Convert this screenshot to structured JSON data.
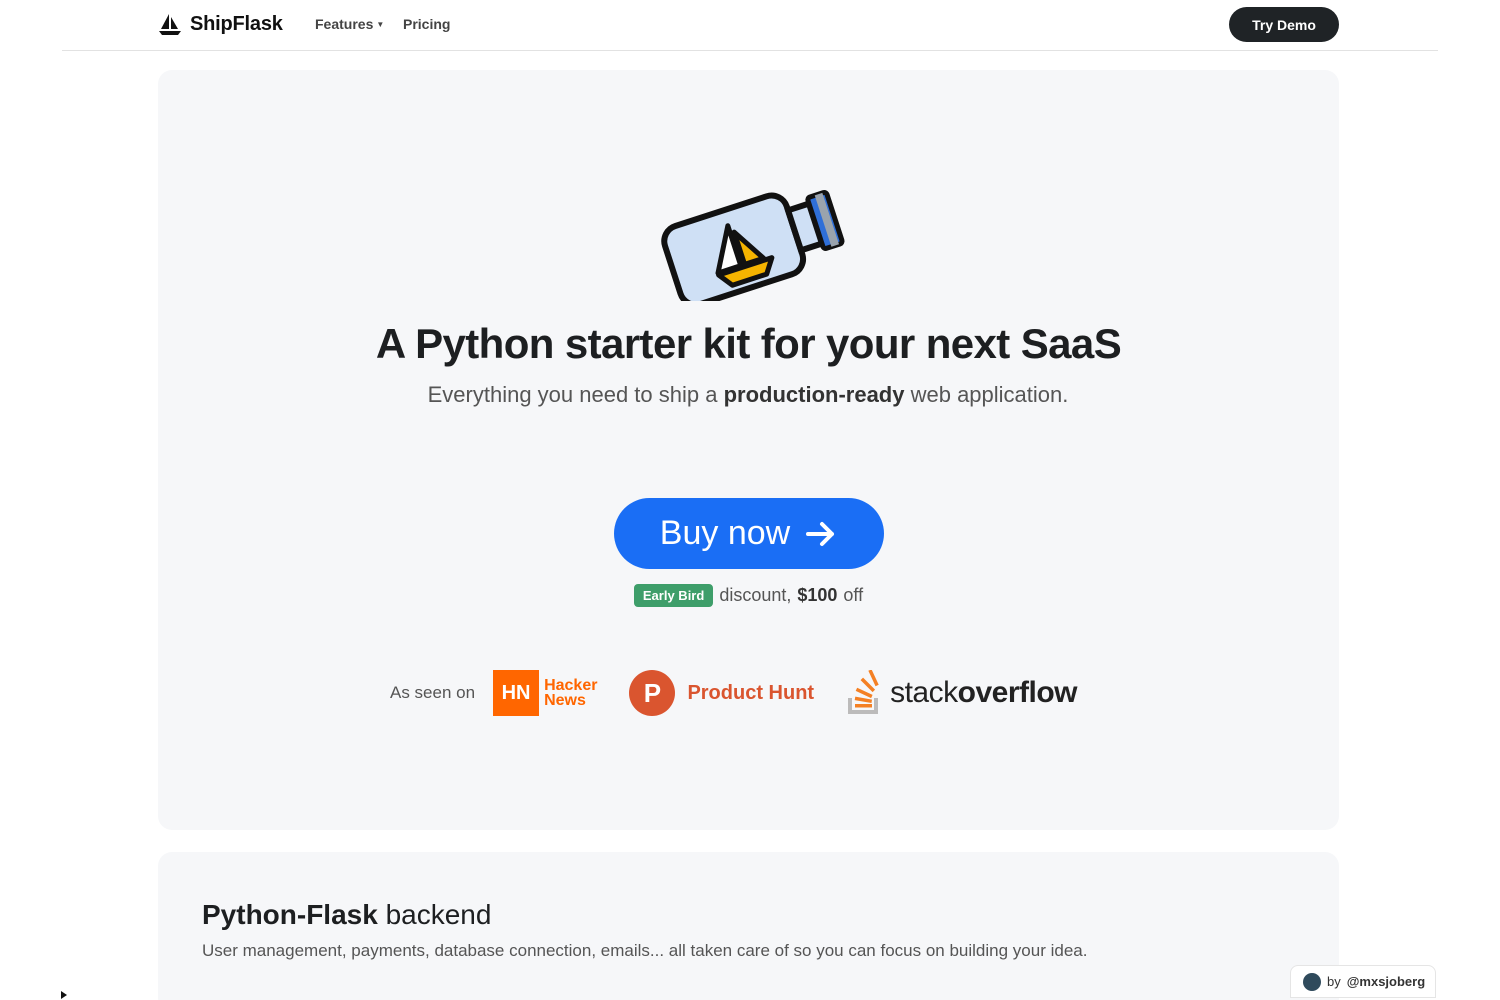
{
  "nav": {
    "brand": "ShipFlask",
    "features_label": "Features",
    "pricing_label": "Pricing",
    "cta_label": "Try Demo"
  },
  "hero": {
    "title": "A Python starter kit for your next SaaS",
    "subtitle_pre": "Everything you need to ship a ",
    "subtitle_bold": "production-ready",
    "subtitle_post": " web application.",
    "buy_label": "Buy now",
    "promo": {
      "badge": "Early Bird",
      "text": "discount,",
      "amount": "$100",
      "suffix": "off"
    },
    "as_seen_on": {
      "label": "As seen on",
      "hn_mark": "HN",
      "hn_line1": "Hacker",
      "hn_line2": "News",
      "ph_mark": "P",
      "ph_name": "Product Hunt",
      "so_stack": "stack",
      "so_overflow": "overflow"
    }
  },
  "section2": {
    "title_bold": "Python-Flask",
    "title_rest": " backend",
    "description": "User management, payments, database connection, emails... all taken care of so you can focus on building your idea."
  },
  "credit": {
    "prefix": "by",
    "handle": "@mxsjoberg"
  },
  "colors": {
    "primary_button": "#1a6ef5",
    "dark_button": "#1f2326",
    "badge_green": "#3e9e6a",
    "hacker_news": "#ff6600",
    "product_hunt": "#da552f",
    "hero_bg": "#f6f7f9"
  },
  "icons": [
    "sailboat-logo-icon",
    "chevron-down-icon",
    "bottle-ship-illustration",
    "arrow-right-icon",
    "stackoverflow-icon"
  ]
}
